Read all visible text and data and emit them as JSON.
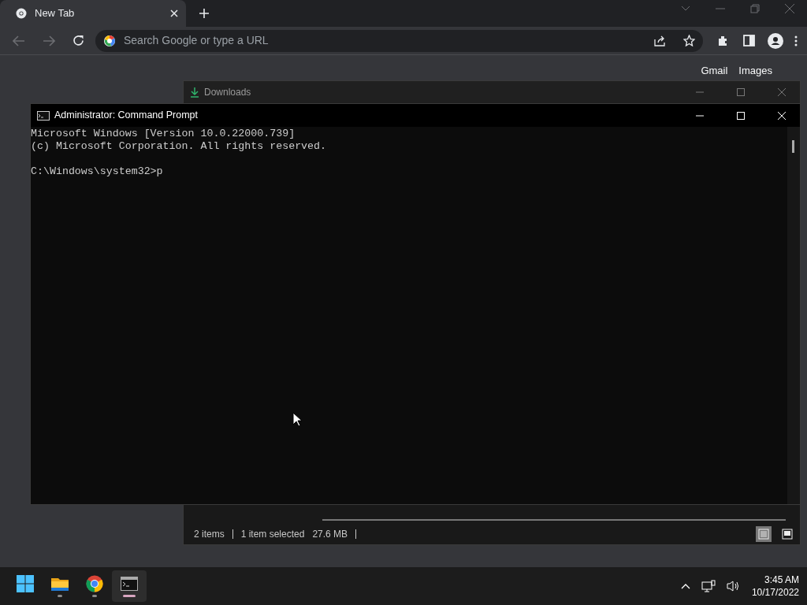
{
  "browser": {
    "tab": {
      "title": "New Tab"
    },
    "omnibox": {
      "placeholder": "Search Google or type a URL"
    },
    "page_links": [
      "Gmail",
      "Images"
    ]
  },
  "downloads_window": {
    "title": "Downloads",
    "status_bar": [
      "2 items",
      "1 item selected",
      "27.6 MB"
    ],
    "view_buttons": [
      {
        "kind": "details",
        "selected": true
      },
      {
        "kind": "thumbnails",
        "selected": false
      }
    ]
  },
  "cmd_window": {
    "title": "Administrator: Command Prompt",
    "output": [
      "Microsoft Windows [Version 10.0.22000.739]",
      "(c) Microsoft Corporation. All rights reserved."
    ],
    "prompt": "C:\\Windows\\system32>p"
  },
  "taskbar": {
    "apps": [
      {
        "kind": "start",
        "running": false,
        "selected": false
      },
      {
        "kind": "explorer",
        "running": true,
        "selected": false
      },
      {
        "kind": "chrome",
        "running": true,
        "selected": false
      },
      {
        "kind": "terminal",
        "running": true,
        "selected": true
      }
    ],
    "clock": {
      "time": "3:45 AM",
      "date": "10/17/2022"
    }
  }
}
